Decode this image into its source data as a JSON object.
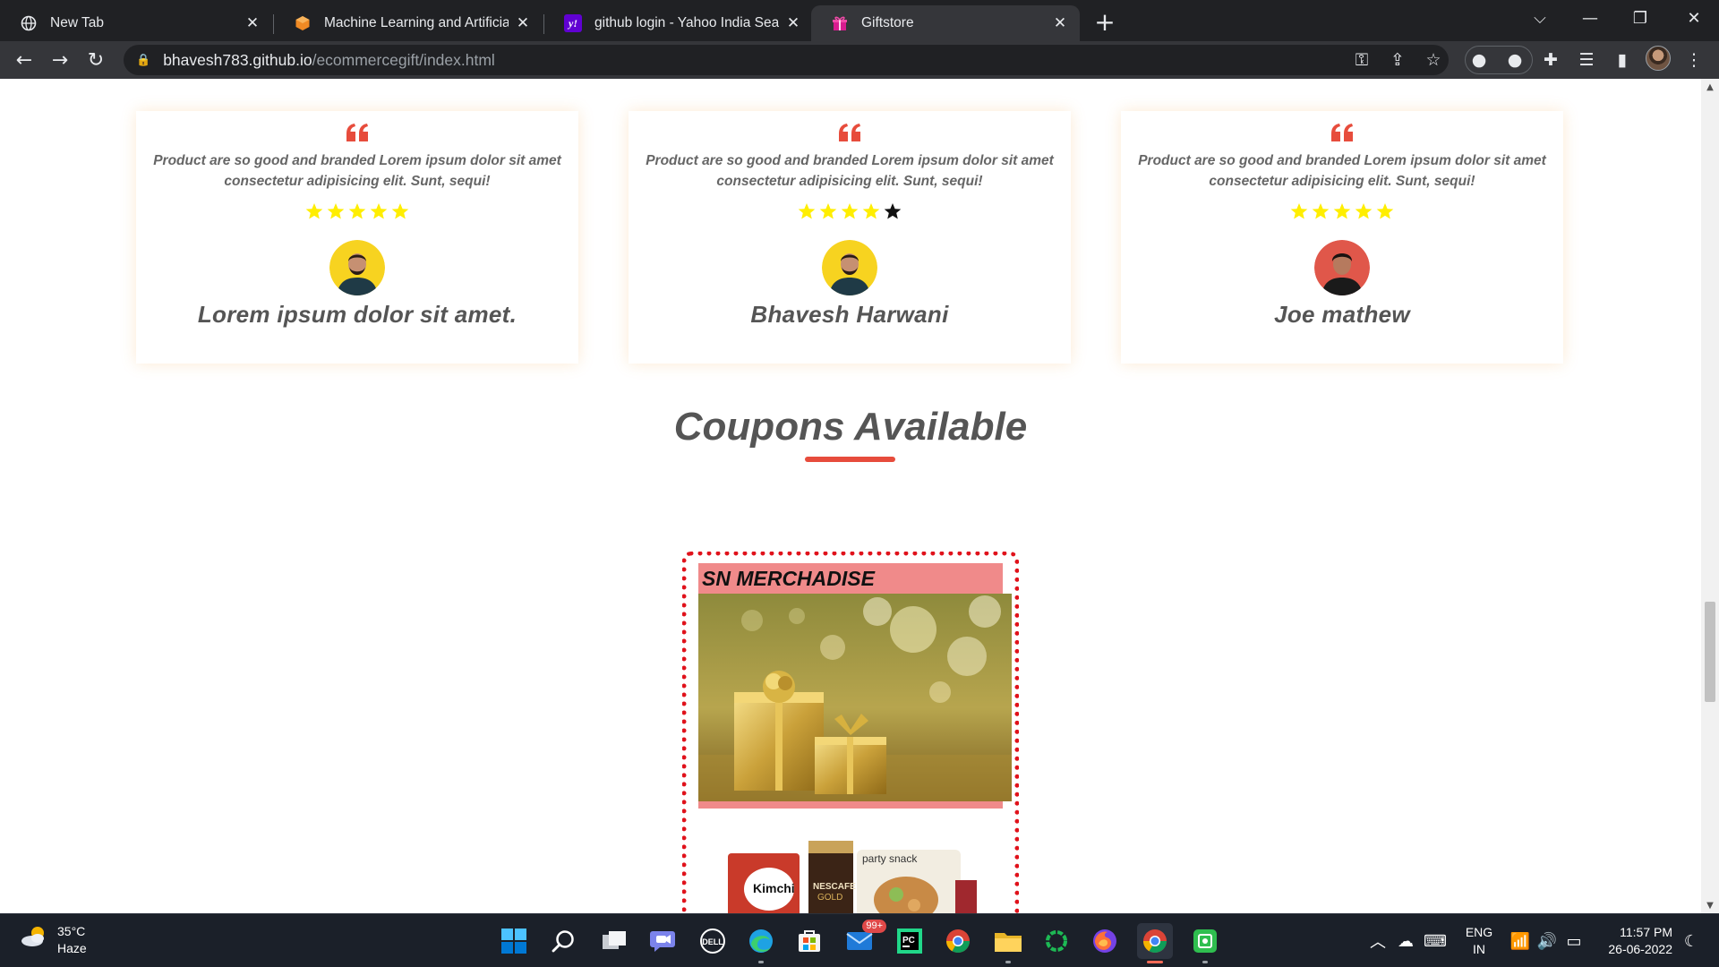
{
  "browser": {
    "tabs": [
      {
        "title": "New Tab",
        "favicon": "globe-icon",
        "active": false
      },
      {
        "title": "Machine Learning and Artificial Intelligence",
        "favicon": "orange-cube-icon",
        "active": false
      },
      {
        "title": "github login - Yahoo India Search Results",
        "favicon": "yahoo-icon",
        "active": false
      },
      {
        "title": "Giftstore",
        "favicon": "gift-icon",
        "active": true
      }
    ],
    "url_domain": "bhavesh783.github.io",
    "url_path": "/ecommercegift/index.html"
  },
  "page": {
    "reviews": [
      {
        "text": "Product are so good and branded Lorem ipsum dolor sit amet consectetur adipisicing elit. Sunt, sequi!",
        "stars": 5,
        "name": "Lorem ipsum dolor sit amet."
      },
      {
        "text": "Product are so good and branded Lorem ipsum dolor sit amet consectetur adipisicing elit. Sunt, sequi!",
        "stars": 4,
        "name": "Bhavesh Harwani"
      },
      {
        "text": "Product are so good and branded Lorem ipsum dolor sit amet consectetur adipisicing elit. Sunt, sequi!",
        "stars": 5,
        "name": "Joe mathew"
      }
    ],
    "coupons_heading": "Coupons Available",
    "coupon": {
      "header": "SN MERCHADISE"
    },
    "colors": {
      "accent": "#e74c3c",
      "star_filled": "#ffee00",
      "coupon_border": "#e0121b",
      "coupon_header": "#f08a8a"
    }
  },
  "taskbar": {
    "weather_temp": "35°C",
    "weather_desc": "Haze",
    "mail_badge": "99+",
    "lang_top": "ENG",
    "lang_bottom": "IN",
    "time": "11:57 PM",
    "date": "26-06-2022"
  }
}
